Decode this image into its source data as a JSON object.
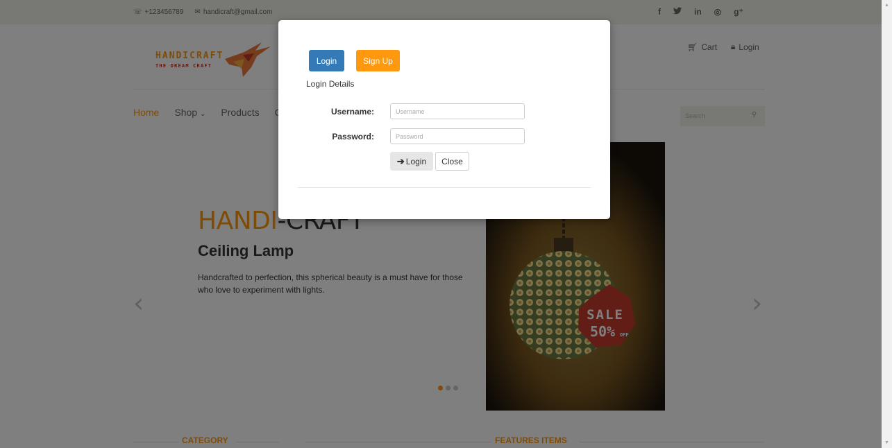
{
  "topbar": {
    "phone": "+123456789",
    "email": "handicraft@gmail.com",
    "social_icons": [
      "facebook-icon",
      "twitter-icon",
      "linkedin-icon",
      "dribbble-icon",
      "google-plus-icon"
    ],
    "social": {
      "facebook": "f",
      "twitter": "🐦",
      "linkedin": "in",
      "dribbble": "◎",
      "google_plus": "g⁺"
    }
  },
  "logo": {
    "brand": "HANDICRAFT",
    "tagline": "THE DREAM CRAFT"
  },
  "header": {
    "cart_label": "Cart",
    "login_label": "Login"
  },
  "nav": {
    "items": [
      "Home",
      "Shop",
      "Products",
      "C"
    ]
  },
  "search": {
    "placeholder": "Search"
  },
  "slider": {
    "title_highlight": "HANDI",
    "title_rest": "-CRAFT",
    "subtitle": "Ceiling Lamp",
    "description": "Handcrafted to perfection, this spherical beauty is a must have for those who love to experiment with lights.",
    "sale_word": "SALE",
    "sale_pct": "50%",
    "sale_off": "OFF",
    "active_slide": 1,
    "slide_count": 3
  },
  "sections": {
    "category": "CATEGORY",
    "features": "FEATURES ITEMS"
  },
  "modal": {
    "tab_login": "Login",
    "tab_signup": "Sign Up",
    "heading": "Login Details",
    "username_label": "Username:",
    "username_placeholder": "Username",
    "password_label": "Password:",
    "password_placeholder": "Password",
    "login_button": "Login",
    "close_button": "Close"
  },
  "colors": {
    "accent": "#fe980f",
    "primary": "#337ab7",
    "overlay": "rgba(0,0,0,0.5)"
  }
}
